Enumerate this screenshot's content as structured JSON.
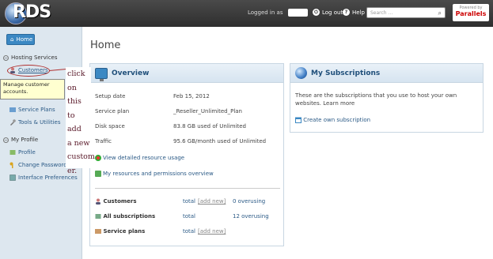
{
  "header": {
    "logo_text": "RDS",
    "logged_in_as": "Logged in as",
    "logout": "Log out",
    "help": "Help",
    "search_placeholder": "Search ...",
    "powered_by": "Powered by",
    "powered_brand": "Parallels"
  },
  "sidebar": {
    "home": "Home",
    "section_hosting": "Hosting Services",
    "customers": "Customers",
    "tooltip": "Manage customer accounts.",
    "service_plans": "Service Plans",
    "tools": "Tools & Utilities",
    "section_profile": "My Profile",
    "profile": "Profile",
    "change_password": "Change Password",
    "interface_prefs": "Interface Preferences"
  },
  "annotation": {
    "lines": [
      "click",
      "on this",
      "to add",
      "a new",
      "custom",
      "er."
    ]
  },
  "main": {
    "title": "Home"
  },
  "overview": {
    "title": "Overview",
    "setup_label": "Setup date",
    "setup_value": "Feb 15, 2012",
    "plan_label": "Service plan",
    "plan_value": "_Reseller_Unlimited_Plan",
    "disk_label": "Disk space",
    "disk_value": "83.8 GB used of Unlimited",
    "traffic_label": "Traffic",
    "traffic_value": "95.6 GB/month used of Unlimited",
    "link_usage": "View detailed resource usage",
    "link_resources": "My resources and permissions overview",
    "stats": [
      {
        "label": "Customers",
        "total": "total",
        "add": "[add new]",
        "extra": "0 overusing"
      },
      {
        "label": "All subscriptions",
        "total": "total",
        "add": "",
        "extra": "12 overusing"
      },
      {
        "label": "Service plans",
        "total": "total",
        "add": "[add new]",
        "extra": ""
      }
    ]
  },
  "subscriptions": {
    "title": "My Subscriptions",
    "desc": "These are the subscriptions that you use to host your own websites. Learn more",
    "create": "Create own subscription"
  },
  "colors": {
    "topbar": "#3a3a3a",
    "sidebar": "#dde7ef",
    "accent": "#3b88c3",
    "link": "#2b5a86"
  }
}
